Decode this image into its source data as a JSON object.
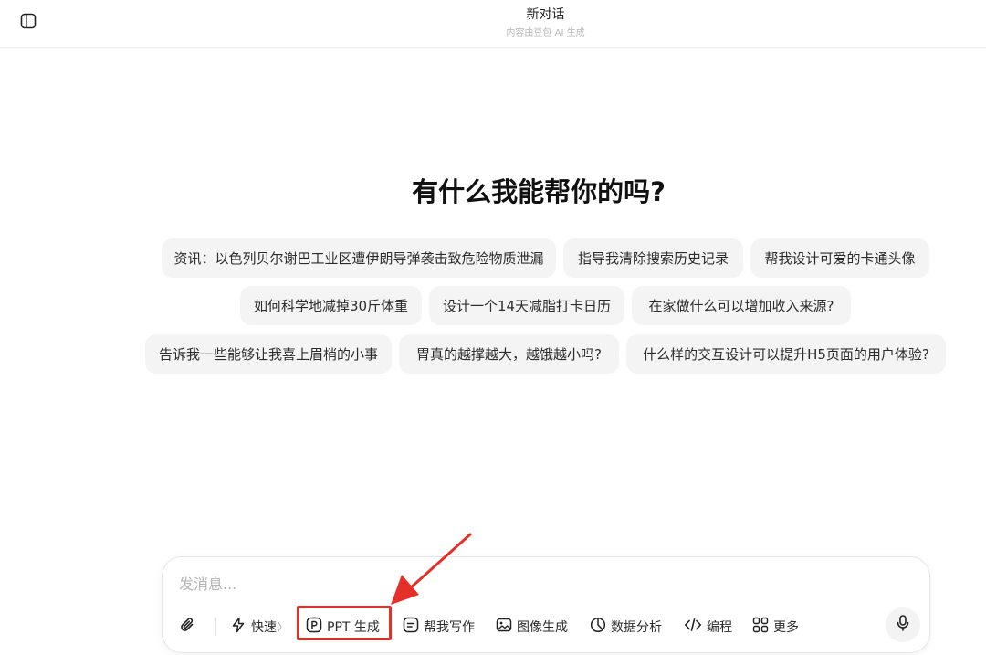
{
  "header": {
    "title": "新对话",
    "subtitle": "内容由豆包 AI 生成"
  },
  "main": {
    "heading": "有什么我能帮你的吗?",
    "suggestions": [
      "资讯：以色列贝尔谢巴工业区遭伊朗导弹袭击致危险物质泄漏",
      "指导我清除搜索历史记录",
      "帮我设计可爱的卡通头像",
      "如何科学地减掉30斤体重",
      "设计一个14天减脂打卡日历",
      "在家做什么可以增加收入来源?",
      "告诉我一些能够让我喜上眉梢的小事",
      "胃真的越撑越大，越饿越小吗?",
      "什么样的交互设计可以提升H5页面的用户体验?"
    ]
  },
  "composer": {
    "placeholder": "发消息...",
    "tools": {
      "quick": "快速",
      "quick_chevron": "〉",
      "ppt": "PPT 生成",
      "write": "帮我写作",
      "image": "图像生成",
      "data": "数据分析",
      "code": "编程",
      "more": "更多"
    }
  },
  "icons": {
    "sidebar_toggle": "sidebar-toggle-icon",
    "attach": "paperclip-icon",
    "quick": "lightning-icon",
    "ppt": "ppt-icon",
    "write": "write-icon",
    "image": "image-icon",
    "data": "pie-chart-icon",
    "code": "code-icon",
    "more": "grid-icon",
    "mic": "microphone-icon"
  },
  "colors": {
    "annotation_red": "#e5302a",
    "chip_bg": "#f4f4f5"
  }
}
